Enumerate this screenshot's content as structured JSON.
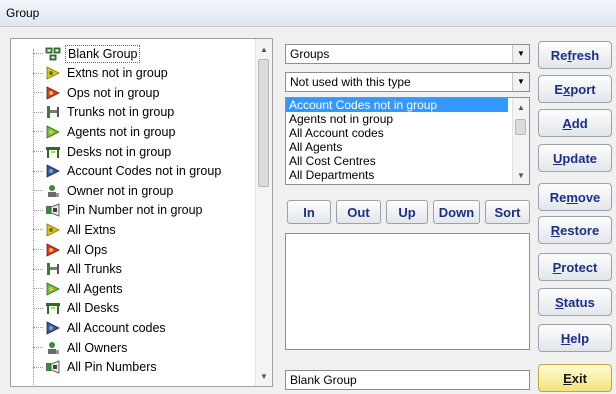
{
  "window": {
    "title": "Group"
  },
  "tree": {
    "items": [
      {
        "label": "Blank Group",
        "icon": "group-icon"
      },
      {
        "label": "Extns not in group",
        "icon": "extension-icon"
      },
      {
        "label": "Ops not in group",
        "icon": "operator-icon"
      },
      {
        "label": "Trunks not in group",
        "icon": "trunk-icon"
      },
      {
        "label": "Agents not in group",
        "icon": "agent-icon"
      },
      {
        "label": "Desks not in group",
        "icon": "desk-icon"
      },
      {
        "label": "Account Codes not in group",
        "icon": "account-code-icon"
      },
      {
        "label": "Owner not in group",
        "icon": "owner-icon"
      },
      {
        "label": "Pin Number not in group",
        "icon": "pin-number-icon"
      },
      {
        "label": "All Extns",
        "icon": "extension-icon"
      },
      {
        "label": "All Ops",
        "icon": "operator-icon"
      },
      {
        "label": "All Trunks",
        "icon": "trunk-icon"
      },
      {
        "label": "All Agents",
        "icon": "agent-icon"
      },
      {
        "label": "All Desks",
        "icon": "desk-icon"
      },
      {
        "label": "All Account codes",
        "icon": "account-code-icon"
      },
      {
        "label": "All Owners",
        "icon": "owner-icon"
      },
      {
        "label": "All Pin Numbers",
        "icon": "pin-number-icon"
      }
    ]
  },
  "combo_groups": {
    "value": "Groups"
  },
  "combo_type": {
    "value": "Not used with this type"
  },
  "list": {
    "items": [
      "Account Codes not in group",
      "Agents not in group",
      "All Account codes",
      "All Agents",
      "All Cost Centres",
      "All Departments"
    ],
    "selected_index": 0
  },
  "move_buttons": {
    "in": "In",
    "out": "Out",
    "up": "Up",
    "down": "Down",
    "sort": "Sort"
  },
  "name_field": {
    "value": "Blank Group"
  },
  "actions": {
    "refresh": {
      "pre": "Re",
      "key": "f",
      "post": "resh"
    },
    "export": {
      "pre": "E",
      "key": "x",
      "post": "port"
    },
    "add": {
      "pre": "",
      "key": "A",
      "post": "dd"
    },
    "update": {
      "pre": "",
      "key": "U",
      "post": "pdate"
    },
    "remove": {
      "pre": "Re",
      "key": "m",
      "post": "ove"
    },
    "restore": {
      "pre": "",
      "key": "R",
      "post": "estore"
    },
    "protect": {
      "pre": "",
      "key": "P",
      "post": "rotect"
    },
    "status": {
      "pre": "",
      "key": "S",
      "post": "tatus"
    },
    "help": {
      "pre": "",
      "key": "H",
      "post": "elp"
    },
    "exit": {
      "pre": "",
      "key": "E",
      "post": "xit"
    }
  }
}
